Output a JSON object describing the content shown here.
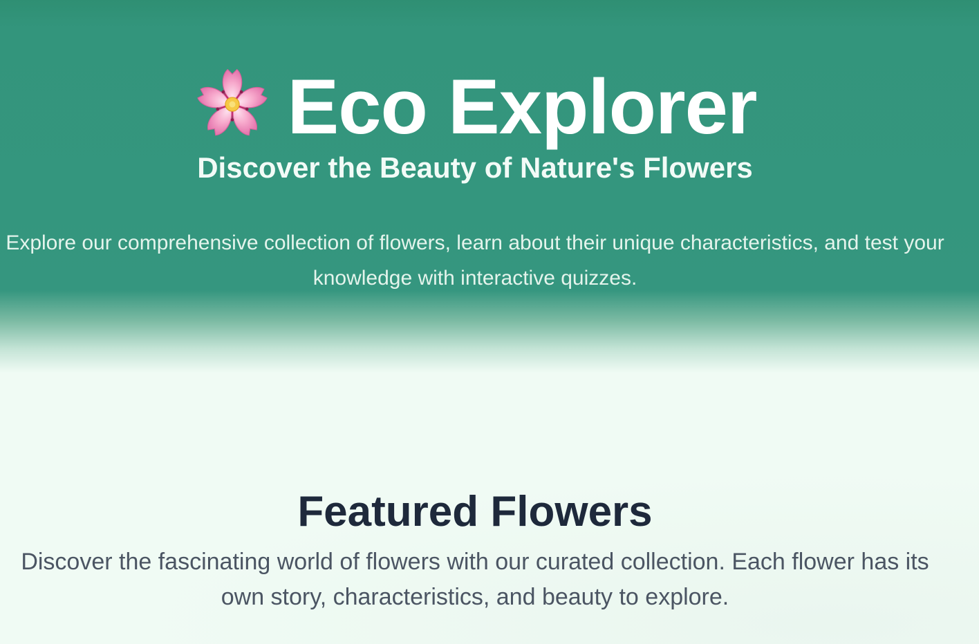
{
  "hero": {
    "icon": "cherry-blossom-icon",
    "title": "Eco Explorer",
    "subtitle": "Discover the Beauty of Nature's Flowers",
    "description": "Explore our comprehensive collection of flowers, learn about their unique characteristics, and test your knowledge with interactive quizzes.",
    "colors": {
      "hero_green": "#35967f",
      "page_background": "#f0fbf4"
    }
  },
  "featured": {
    "title": "Featured Flowers",
    "description": "Discover the fascinating world of flowers with our curated collection. Each flower has its own story, characteristics, and beauty to explore.",
    "colors": {
      "title": "#1e293b",
      "text": "#4b5563"
    }
  }
}
